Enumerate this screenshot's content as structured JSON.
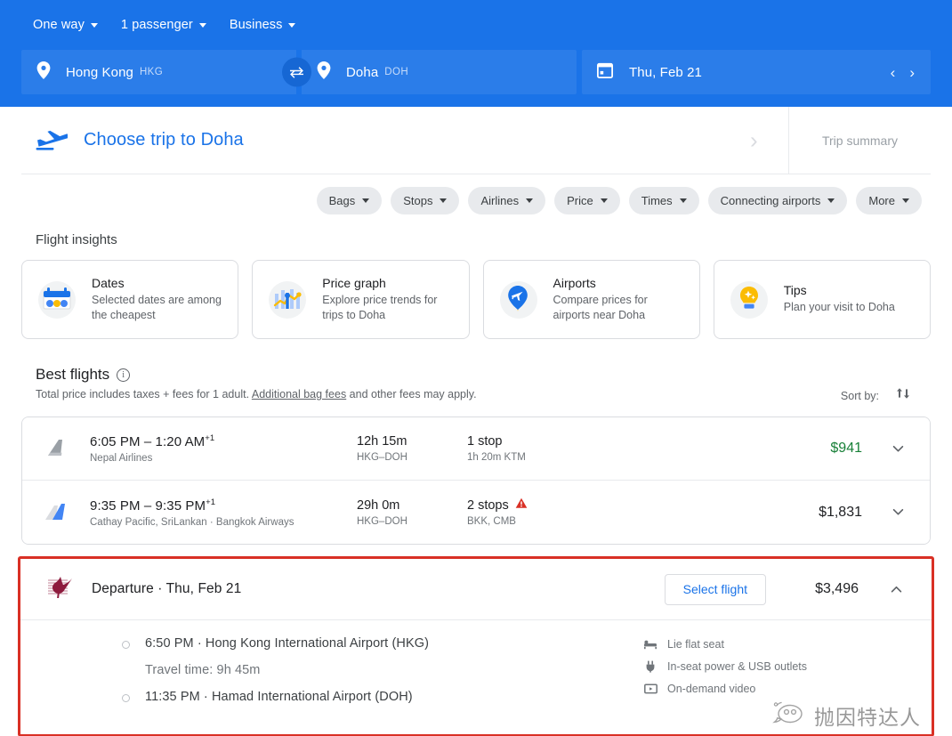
{
  "search": {
    "trip_type": "One way",
    "passengers": "1 passenger",
    "cabin_class": "Business",
    "origin_city": "Hong Kong",
    "origin_code": "HKG",
    "destination_city": "Doha",
    "destination_code": "DOH",
    "date": "Thu, Feb 21",
    "prev_arrow": "‹",
    "next_arrow": "›",
    "accent_color": "#1a73e8",
    "field_color": "#2b7de9"
  },
  "trip_bar": {
    "title": "Choose trip to Doha",
    "summary_label": "Trip summary"
  },
  "filters": [
    {
      "label": "Bags"
    },
    {
      "label": "Stops"
    },
    {
      "label": "Airlines"
    },
    {
      "label": "Price"
    },
    {
      "label": "Times"
    },
    {
      "label": "Connecting airports"
    },
    {
      "label": "More"
    }
  ],
  "insights": {
    "heading": "Flight insights",
    "cards": [
      {
        "icon": "calendar-icon",
        "title": "Dates",
        "subtitle": "Selected dates are among the cheapest"
      },
      {
        "icon": "price-graph-icon",
        "title": "Price graph",
        "subtitle": "Explore price trends for trips to Doha"
      },
      {
        "icon": "airport-pin-icon",
        "title": "Airports",
        "subtitle": "Compare prices for airports near Doha"
      },
      {
        "icon": "lightbulb-icon",
        "title": "Tips",
        "subtitle": "Plan your visit to Doha"
      }
    ]
  },
  "best_flights": {
    "heading": "Best flights",
    "disclaimer_prefix": "Total price includes taxes + fees for 1 adult. ",
    "disclaimer_link": "Additional bag fees",
    "disclaimer_suffix": " and other fees may apply.",
    "sort_label": "Sort by:",
    "rows": [
      {
        "logo": "nepal-airlines-tail-icon",
        "times": "6:05 PM – 1:20 AM",
        "day_offset": "+1",
        "airlines": "Nepal Airlines",
        "duration": "12h 15m",
        "route": "HKG–DOH",
        "stops": "1 stop",
        "stops_warning": false,
        "stop_detail": "1h 20m KTM",
        "price": "$941",
        "price_highlight": true,
        "expand_icon": "chevron-down-icon"
      },
      {
        "logo": "cathay-pacific-tail-icon",
        "times": "9:35 PM – 9:35 PM",
        "day_offset": "+1",
        "airlines": "Cathay Pacific, SriLankan · Bangkok Airways",
        "duration": "29h 0m",
        "route": "HKG–DOH",
        "stops": "2 stops",
        "stops_warning": true,
        "stop_detail": "BKK, CMB",
        "price": "$1,831",
        "price_highlight": false,
        "expand_icon": "chevron-down-icon"
      }
    ]
  },
  "selected_flight": {
    "logo": "qatar-airways-oryx-icon",
    "title": "Departure · Thu, Feb 21",
    "select_button": "Select flight",
    "price": "$3,496",
    "collapse_icon": "chevron-up-icon",
    "border_color": "#d93025",
    "legs": {
      "departure": "6:50 PM · Hong Kong International Airport (HKG)",
      "travel_time": "Travel time: 9h 45m",
      "arrival": "11:35 PM · Hamad International Airport (DOH)"
    },
    "amenities": [
      {
        "icon": "lie-flat-seat-icon",
        "label": "Lie flat seat"
      },
      {
        "icon": "power-outlet-icon",
        "label": "In-seat power & USB outlets"
      },
      {
        "icon": "on-demand-video-icon",
        "label": "On-demand video"
      }
    ]
  },
  "watermark": {
    "text": "抛因特达人",
    "logo": "chat-bird-logo"
  }
}
